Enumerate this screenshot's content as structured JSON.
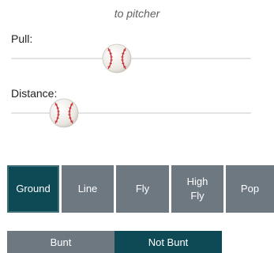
{
  "hint_text": "to pitcher",
  "sliders": {
    "pull": {
      "label": "Pull:",
      "value": 0.44
    },
    "distance": {
      "label": "Distance:",
      "value": 0.22
    }
  },
  "hit_types": [
    {
      "label": "Ground",
      "selected": true
    },
    {
      "label": "Line",
      "selected": false
    },
    {
      "label": "Fly",
      "selected": false
    },
    {
      "label": "High\nFly",
      "selected": false
    },
    {
      "label": "Pop",
      "selected": false
    }
  ],
  "bunt_options": [
    {
      "label": "Bunt",
      "selected": false
    },
    {
      "label": "Not Bunt",
      "selected": true
    }
  ],
  "colors": {
    "selected": "#0e4a56",
    "unselected": "#6d7881",
    "track": "#e3e3e3"
  },
  "icons": {
    "slider_thumb": "baseball-icon"
  }
}
